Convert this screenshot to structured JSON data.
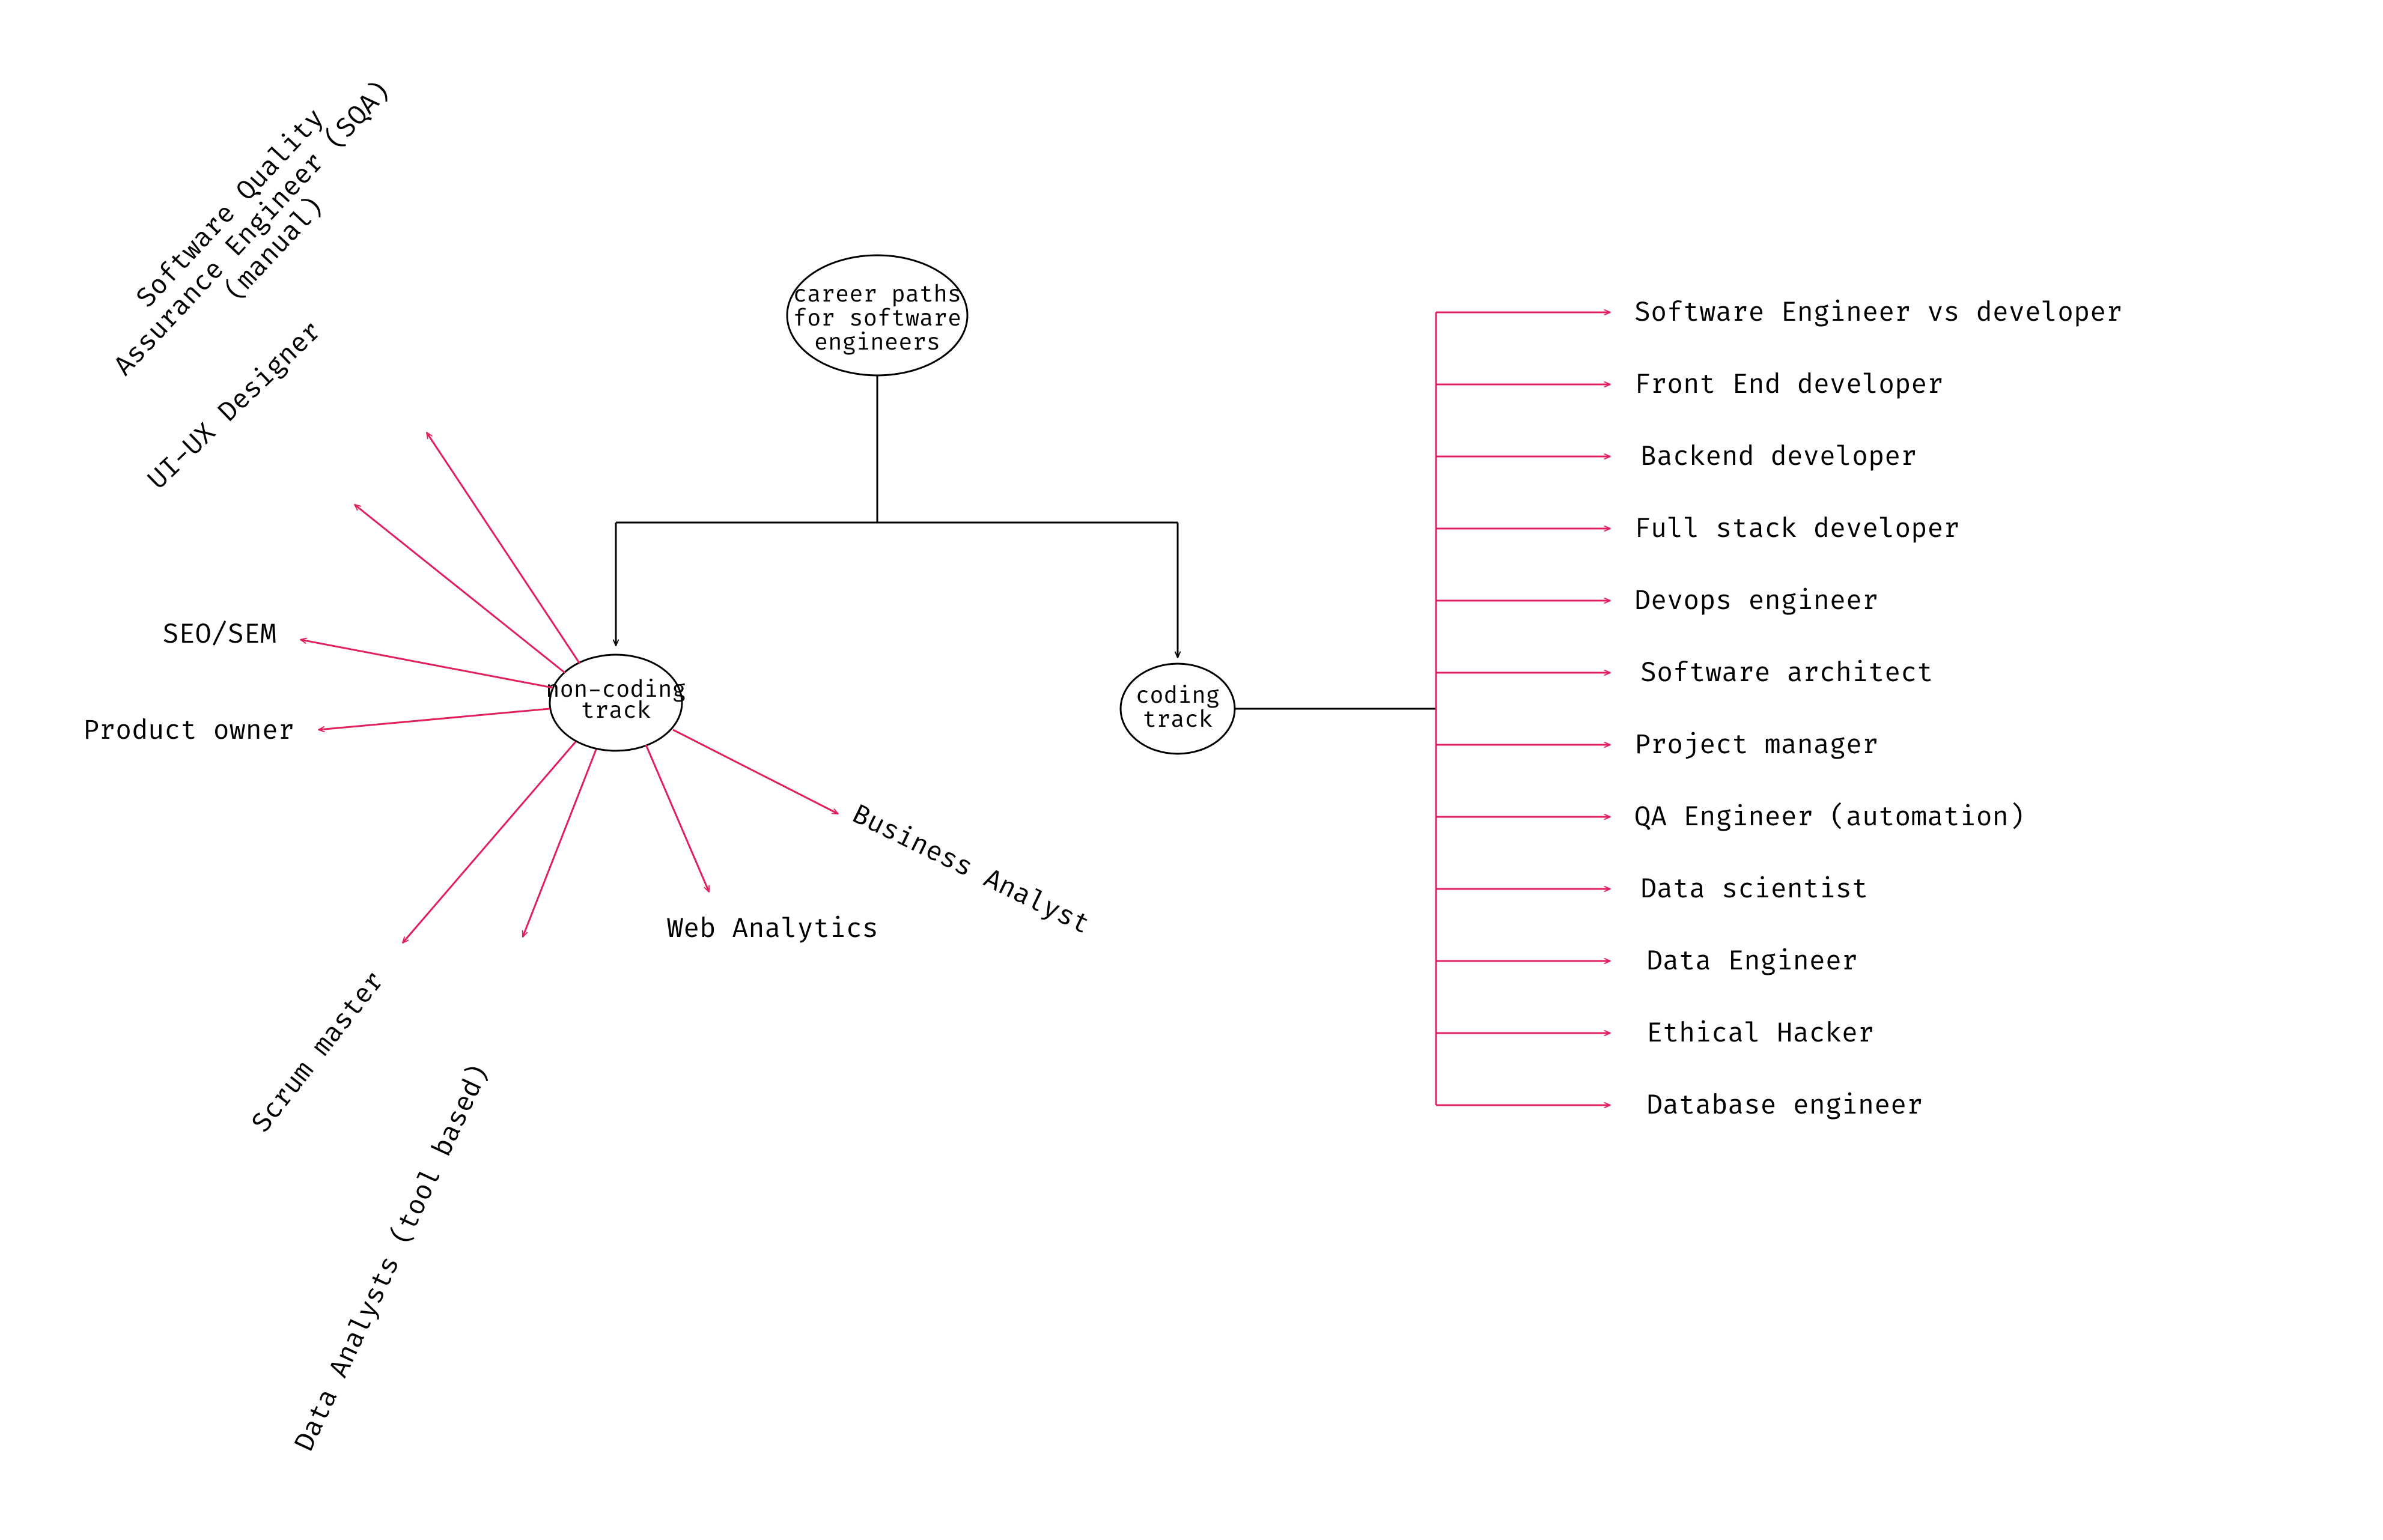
{
  "root": {
    "line1": "career paths",
    "line2": "for software",
    "line3": "engineers"
  },
  "nonCoding": {
    "line1": "non-coding",
    "line2": "track"
  },
  "coding": {
    "line1": "coding",
    "line2": "track"
  },
  "codingItems": [
    "Software Engineer vs developer",
    "Front End developer",
    "Backend developer",
    "Full stack developer",
    "Devops engineer",
    "Software architect",
    "Project manager",
    "QA Engineer (automation)",
    "Data scientist",
    "Data Engineer",
    "Ethical Hacker",
    "Database engineer"
  ],
  "nc": {
    "sqa_l1": "Software Quality",
    "sqa_l2": "Assurance Engineer (SQA)",
    "sqa_l3": "(manual)",
    "uiux": "UI-UX Designer",
    "seosem": "SEO/SEM",
    "productOwner": "Product owner",
    "scrumMaster": "Scrum master",
    "dataAnalysts": "Data Analysts (tool based)",
    "webAnalytics": "Web Analytics",
    "businessAnalyst": "Business Analyst"
  },
  "colors": {
    "black": "#000000",
    "red": "#e11f5a"
  }
}
